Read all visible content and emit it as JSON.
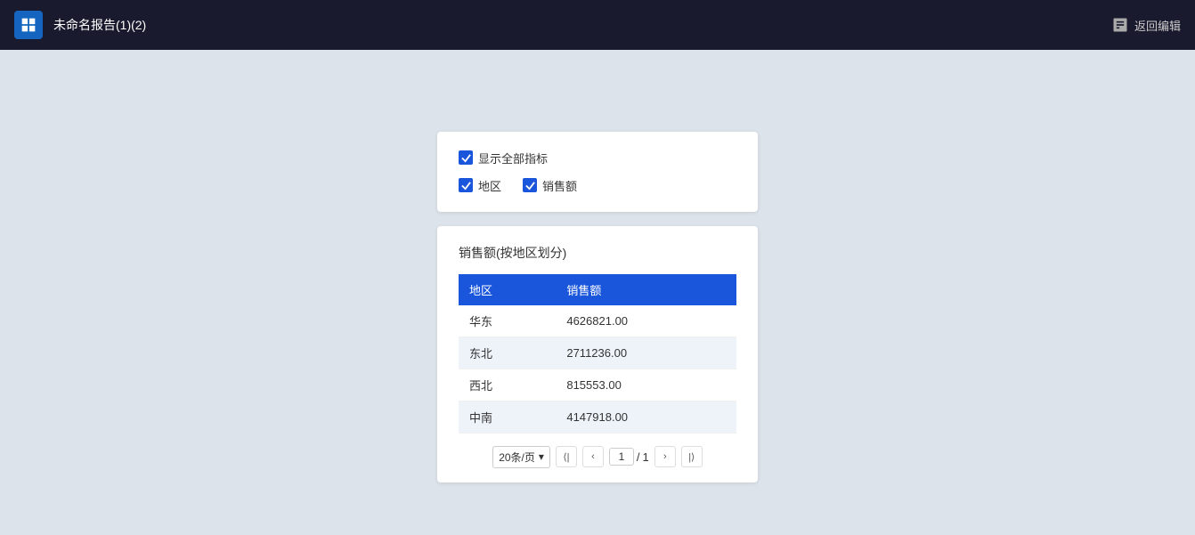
{
  "header": {
    "title": "未命名报告(1)(2)",
    "back_label": "返回编辑",
    "logo_alt": "dataease-logo"
  },
  "filter": {
    "show_all_label": "显示全部指标",
    "show_all_checked": true,
    "fields": [
      {
        "label": "地区",
        "checked": true
      },
      {
        "label": "销售额",
        "checked": true
      }
    ]
  },
  "table": {
    "title": "销售额(按地区划分)",
    "columns": [
      "地区",
      "销售额"
    ],
    "rows": [
      {
        "region": "华东",
        "amount": "4626821.00"
      },
      {
        "region": "东北",
        "amount": "2711236.00"
      },
      {
        "region": "西北",
        "amount": "815553.00"
      },
      {
        "region": "中南",
        "amount": "4147918.00"
      }
    ],
    "pagination": {
      "per_page": "20条/页",
      "current": "1",
      "total": "1"
    }
  }
}
